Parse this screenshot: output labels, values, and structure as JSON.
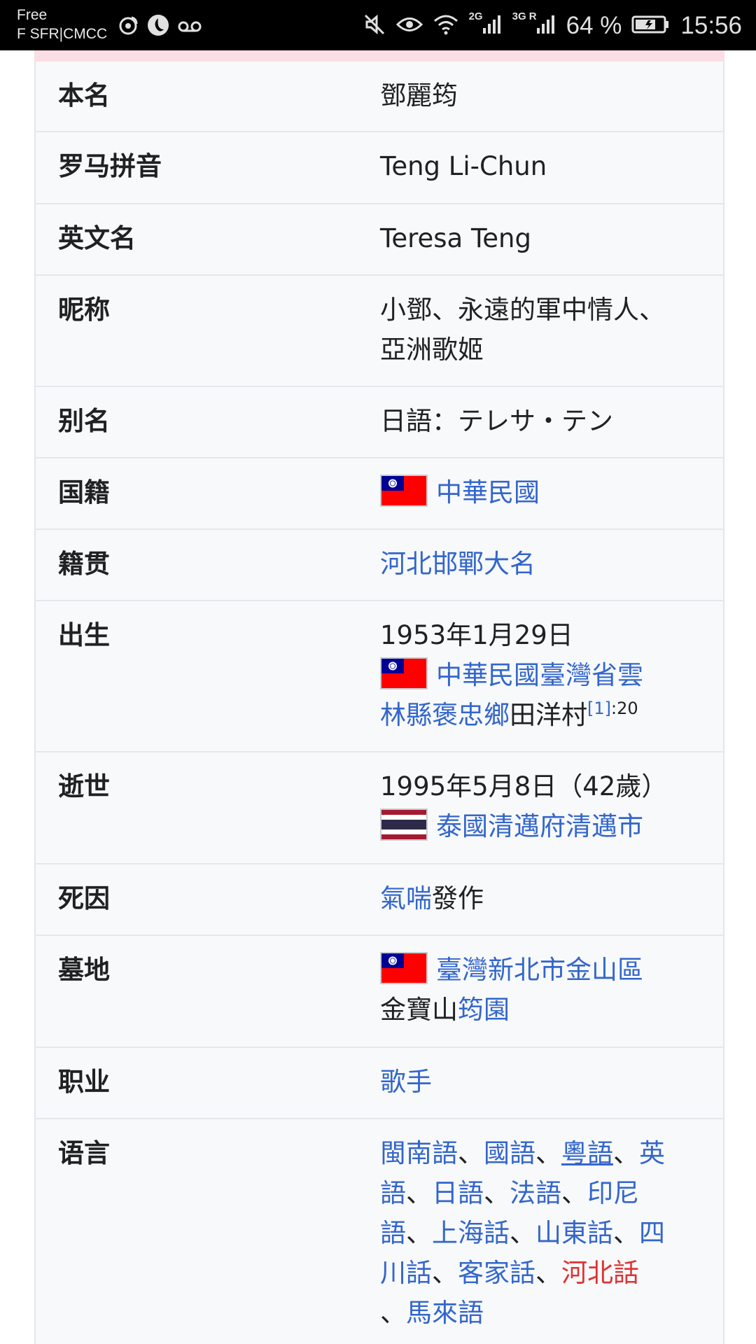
{
  "status_bar": {
    "carrier_line1": "Free",
    "carrier_line2": "F SFR|CMCC",
    "net1": "2G",
    "net2": "3G R",
    "battery": "64 %",
    "time": "15:56"
  },
  "infobox": {
    "rows": [
      {
        "label": "本名",
        "value": "鄧麗筠"
      },
      {
        "label": "罗马拼音",
        "value": "Teng Li-Chun"
      },
      {
        "label": "英文名",
        "value": "Teresa Teng"
      },
      {
        "label": "昵称",
        "value_line1": "小鄧、永遠的軍中情人、",
        "value_line2": "亞洲歌姬"
      },
      {
        "label": "别名",
        "value": "日語：テレサ・テン"
      },
      {
        "label": "国籍",
        "link": "中華民國"
      },
      {
        "label": "籍贯",
        "link": "河北邯鄲大名"
      },
      {
        "label": "出生",
        "date": "1953年1月29日",
        "link_line1": "中華民國臺灣省雲",
        "link_line2": "林縣褒忠鄉",
        "plain": "田洋村",
        "ref": "[1]",
        "ref_page": ":20"
      },
      {
        "label": "逝世",
        "date": "1995年5月8日（42歲）",
        "link": "泰國清邁府清邁市"
      },
      {
        "label": "死因",
        "link": "氣喘",
        "plain": "發作"
      },
      {
        "label": "墓地",
        "link": "臺灣新北市金山區",
        "plain": "金寶山",
        "link2": "筠園"
      },
      {
        "label": "职业",
        "link": "歌手"
      },
      {
        "label": "语言",
        "languages": {
          "l1": "閩南語",
          "sep": "、",
          "l2": "國語",
          "l3": "粵語",
          "l4a": "英",
          "l4b": "語",
          "l5": "日語",
          "l6": "法語",
          "l7a": "印尼",
          "l7b": "語",
          "l8": "上海話",
          "l9": "山東話",
          "l10a": "四",
          "l10b": "川話",
          "l11": "客家話",
          "l12": "河北話",
          "l13": "馬來語"
        }
      }
    ]
  },
  "colors": {
    "link": "#3366cc",
    "redlink": "#d33333",
    "infobox_bg": "#f8f9fa",
    "header_accent": "#fbdde6"
  },
  "icons": [
    "weibo-icon",
    "qq-icon",
    "voicemail-icon",
    "mute-icon",
    "eye-icon",
    "wifi-icon",
    "signal-icon",
    "battery-icon",
    "flag-roc-icon",
    "flag-thailand-icon"
  ]
}
